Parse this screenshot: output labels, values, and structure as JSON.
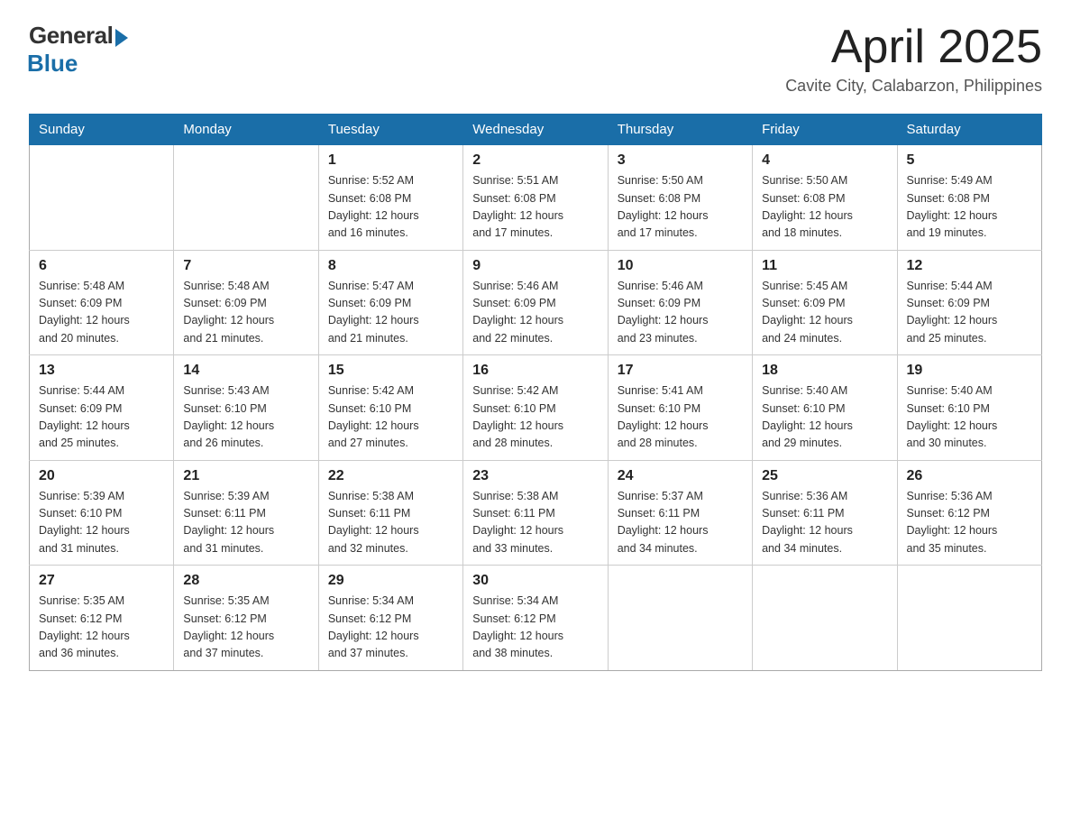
{
  "header": {
    "logo": {
      "general": "General",
      "blue": "Blue"
    },
    "title": "April 2025",
    "location": "Cavite City, Calabarzon, Philippines"
  },
  "days_of_week": [
    "Sunday",
    "Monday",
    "Tuesday",
    "Wednesday",
    "Thursday",
    "Friday",
    "Saturday"
  ],
  "weeks": [
    [
      {
        "day": "",
        "info": ""
      },
      {
        "day": "",
        "info": ""
      },
      {
        "day": "1",
        "info": "Sunrise: 5:52 AM\nSunset: 6:08 PM\nDaylight: 12 hours\nand 16 minutes."
      },
      {
        "day": "2",
        "info": "Sunrise: 5:51 AM\nSunset: 6:08 PM\nDaylight: 12 hours\nand 17 minutes."
      },
      {
        "day": "3",
        "info": "Sunrise: 5:50 AM\nSunset: 6:08 PM\nDaylight: 12 hours\nand 17 minutes."
      },
      {
        "day": "4",
        "info": "Sunrise: 5:50 AM\nSunset: 6:08 PM\nDaylight: 12 hours\nand 18 minutes."
      },
      {
        "day": "5",
        "info": "Sunrise: 5:49 AM\nSunset: 6:08 PM\nDaylight: 12 hours\nand 19 minutes."
      }
    ],
    [
      {
        "day": "6",
        "info": "Sunrise: 5:48 AM\nSunset: 6:09 PM\nDaylight: 12 hours\nand 20 minutes."
      },
      {
        "day": "7",
        "info": "Sunrise: 5:48 AM\nSunset: 6:09 PM\nDaylight: 12 hours\nand 21 minutes."
      },
      {
        "day": "8",
        "info": "Sunrise: 5:47 AM\nSunset: 6:09 PM\nDaylight: 12 hours\nand 21 minutes."
      },
      {
        "day": "9",
        "info": "Sunrise: 5:46 AM\nSunset: 6:09 PM\nDaylight: 12 hours\nand 22 minutes."
      },
      {
        "day": "10",
        "info": "Sunrise: 5:46 AM\nSunset: 6:09 PM\nDaylight: 12 hours\nand 23 minutes."
      },
      {
        "day": "11",
        "info": "Sunrise: 5:45 AM\nSunset: 6:09 PM\nDaylight: 12 hours\nand 24 minutes."
      },
      {
        "day": "12",
        "info": "Sunrise: 5:44 AM\nSunset: 6:09 PM\nDaylight: 12 hours\nand 25 minutes."
      }
    ],
    [
      {
        "day": "13",
        "info": "Sunrise: 5:44 AM\nSunset: 6:09 PM\nDaylight: 12 hours\nand 25 minutes."
      },
      {
        "day": "14",
        "info": "Sunrise: 5:43 AM\nSunset: 6:10 PM\nDaylight: 12 hours\nand 26 minutes."
      },
      {
        "day": "15",
        "info": "Sunrise: 5:42 AM\nSunset: 6:10 PM\nDaylight: 12 hours\nand 27 minutes."
      },
      {
        "day": "16",
        "info": "Sunrise: 5:42 AM\nSunset: 6:10 PM\nDaylight: 12 hours\nand 28 minutes."
      },
      {
        "day": "17",
        "info": "Sunrise: 5:41 AM\nSunset: 6:10 PM\nDaylight: 12 hours\nand 28 minutes."
      },
      {
        "day": "18",
        "info": "Sunrise: 5:40 AM\nSunset: 6:10 PM\nDaylight: 12 hours\nand 29 minutes."
      },
      {
        "day": "19",
        "info": "Sunrise: 5:40 AM\nSunset: 6:10 PM\nDaylight: 12 hours\nand 30 minutes."
      }
    ],
    [
      {
        "day": "20",
        "info": "Sunrise: 5:39 AM\nSunset: 6:10 PM\nDaylight: 12 hours\nand 31 minutes."
      },
      {
        "day": "21",
        "info": "Sunrise: 5:39 AM\nSunset: 6:11 PM\nDaylight: 12 hours\nand 31 minutes."
      },
      {
        "day": "22",
        "info": "Sunrise: 5:38 AM\nSunset: 6:11 PM\nDaylight: 12 hours\nand 32 minutes."
      },
      {
        "day": "23",
        "info": "Sunrise: 5:38 AM\nSunset: 6:11 PM\nDaylight: 12 hours\nand 33 minutes."
      },
      {
        "day": "24",
        "info": "Sunrise: 5:37 AM\nSunset: 6:11 PM\nDaylight: 12 hours\nand 34 minutes."
      },
      {
        "day": "25",
        "info": "Sunrise: 5:36 AM\nSunset: 6:11 PM\nDaylight: 12 hours\nand 34 minutes."
      },
      {
        "day": "26",
        "info": "Sunrise: 5:36 AM\nSunset: 6:12 PM\nDaylight: 12 hours\nand 35 minutes."
      }
    ],
    [
      {
        "day": "27",
        "info": "Sunrise: 5:35 AM\nSunset: 6:12 PM\nDaylight: 12 hours\nand 36 minutes."
      },
      {
        "day": "28",
        "info": "Sunrise: 5:35 AM\nSunset: 6:12 PM\nDaylight: 12 hours\nand 37 minutes."
      },
      {
        "day": "29",
        "info": "Sunrise: 5:34 AM\nSunset: 6:12 PM\nDaylight: 12 hours\nand 37 minutes."
      },
      {
        "day": "30",
        "info": "Sunrise: 5:34 AM\nSunset: 6:12 PM\nDaylight: 12 hours\nand 38 minutes."
      },
      {
        "day": "",
        "info": ""
      },
      {
        "day": "",
        "info": ""
      },
      {
        "day": "",
        "info": ""
      }
    ]
  ]
}
